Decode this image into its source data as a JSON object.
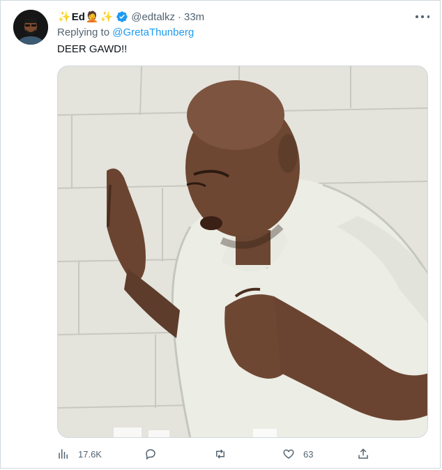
{
  "tweet": {
    "display_name": "Ed",
    "name_emoji_left": "✨",
    "name_emoji_mid": "🤦",
    "name_emoji_right": "✨",
    "handle": "@edtalkz",
    "separator": "·",
    "time": "33m",
    "replying_prefix": "Replying to",
    "replying_to": "@GretaThunberg",
    "text": "DEER GAWD!!",
    "icons": {
      "verified": "verified-badge-icon",
      "more": "more-options-icon",
      "views": "views-analytics-icon",
      "reply": "reply-icon",
      "retweet": "retweet-icon",
      "like": "like-icon",
      "share": "share-icon"
    },
    "colors": {
      "accent": "#1d9bf0",
      "secondary_text": "#536471",
      "border": "#cfd9de"
    }
  },
  "actions": {
    "views_count": "17.6K",
    "reply_count": "",
    "retweet_count": "",
    "like_count": "63"
  }
}
